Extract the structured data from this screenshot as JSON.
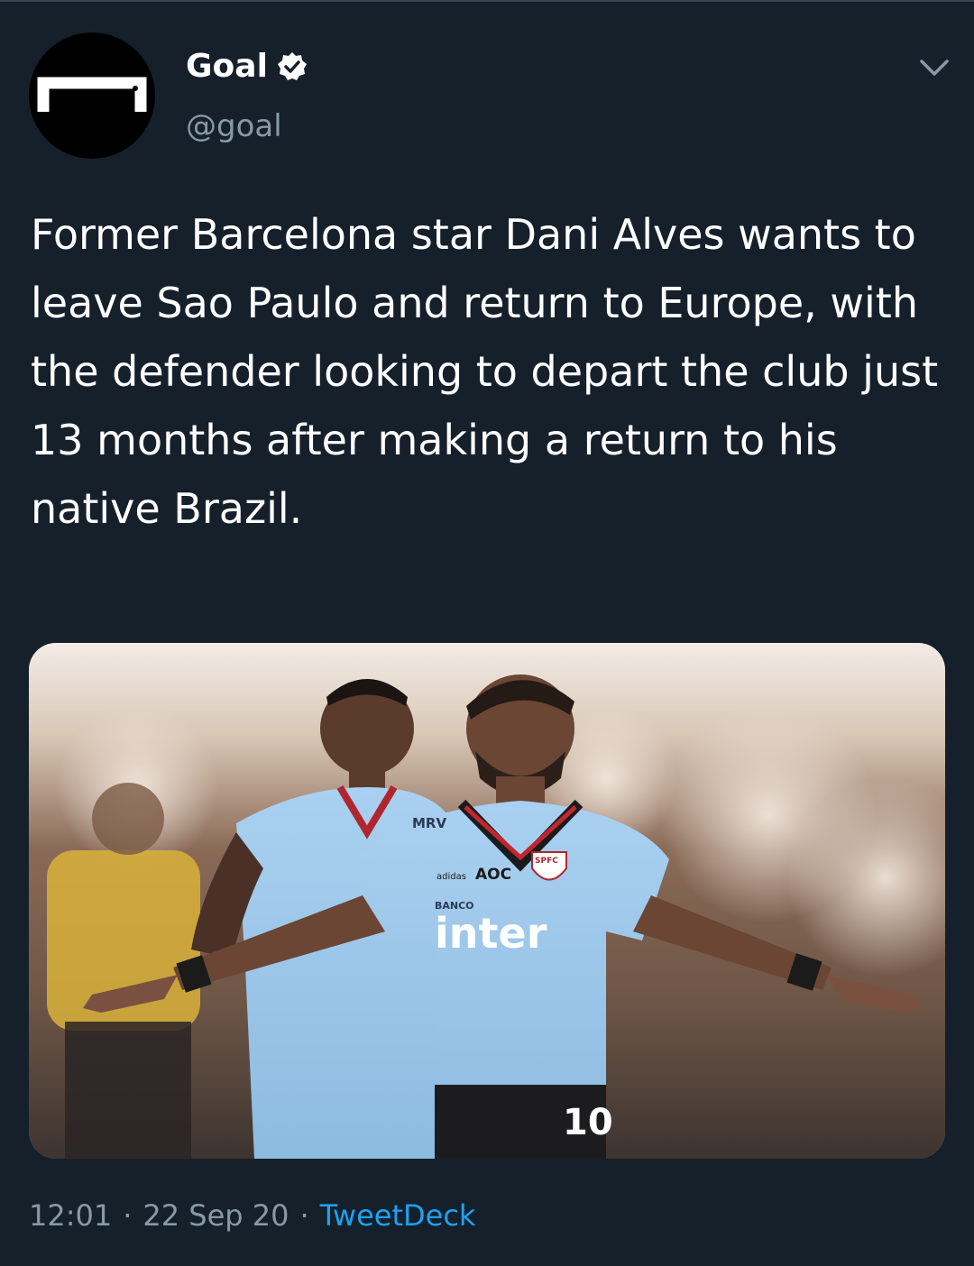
{
  "tweet": {
    "author": {
      "display_name": "Goal",
      "handle": "@goal",
      "verified": true,
      "avatar_icon": "goal-logo-icon"
    },
    "text": "Former Barcelona star Dani Alves wants to leave Sao Paulo and return to Europe, with the defender looking to depart the club just 13 months after making a return to his native Brazil.",
    "media": {
      "description_icon": "tweet-photo",
      "jersey_text": {
        "sponsor_top": "MRV",
        "sponsor_main": "inter",
        "sponsor_bank": "BANCO",
        "brand": "adidas",
        "club_badge": "SPFC",
        "number": "10",
        "aoc": "AOC"
      }
    },
    "time": "12:01",
    "date": "22 Sep 20",
    "source": "TweetDeck",
    "separator": "·"
  },
  "icons": {
    "verified": "verified-badge-icon",
    "more": "chevron-down-icon"
  },
  "colors": {
    "background": "#15202b",
    "secondary_text": "#8899a6",
    "accent": "#1da1f2",
    "jersey": "#9ec7ea"
  }
}
